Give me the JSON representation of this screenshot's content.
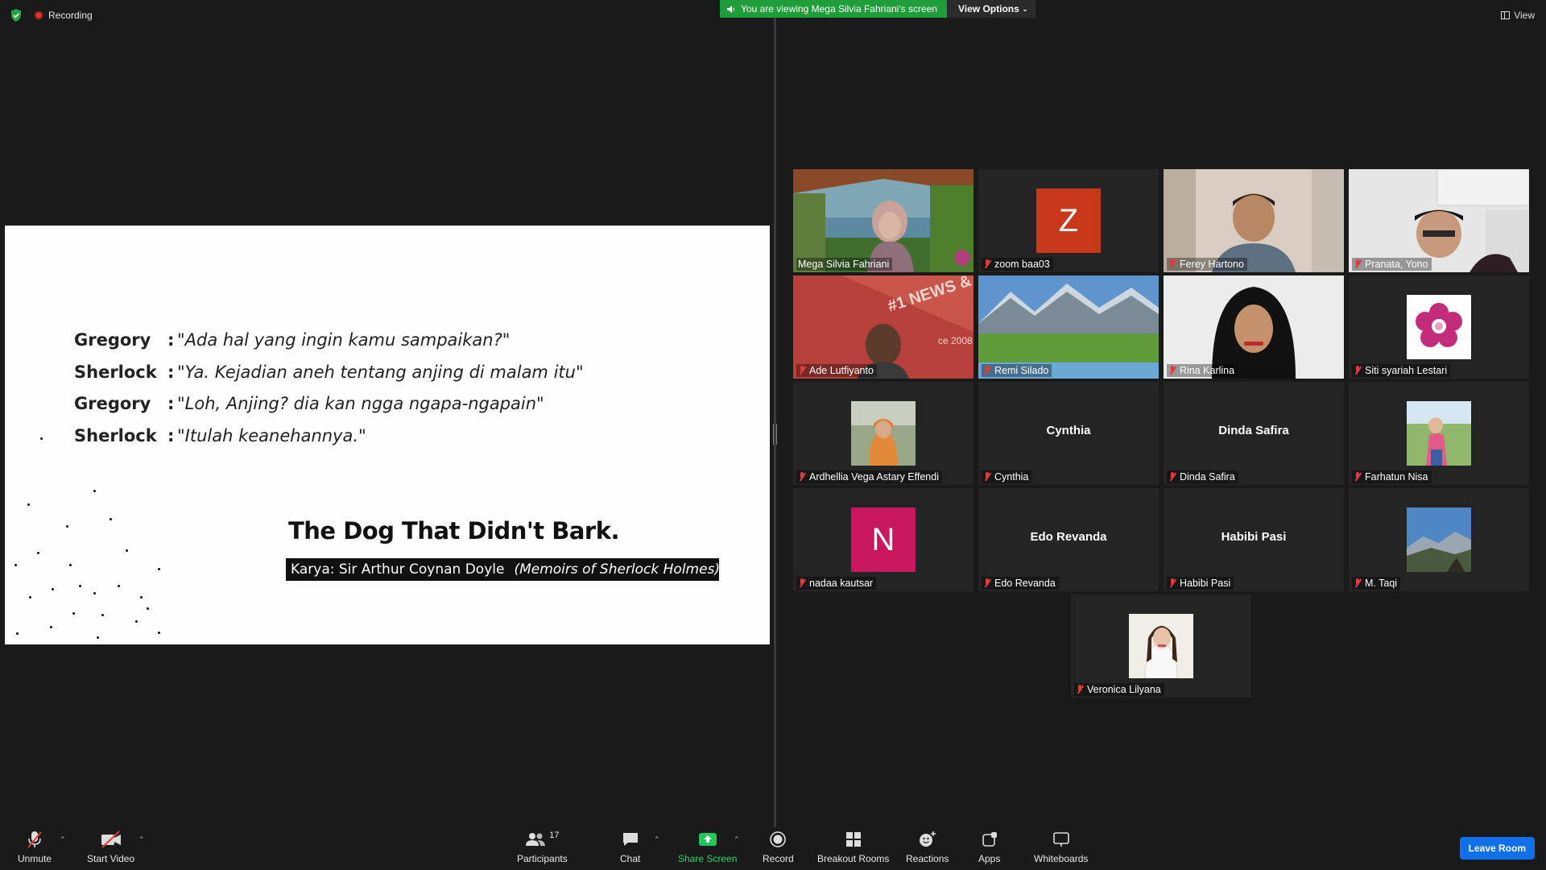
{
  "status": {
    "recording_label": "Recording"
  },
  "banner": {
    "message": "You are viewing Mega Silvia Fahriani's screen",
    "view_options": "View Options"
  },
  "view_button": "View",
  "slide": {
    "dialog": [
      {
        "speaker": "Gregory",
        "colon": ":",
        "line": "\"Ada hal yang ingin kamu sampaikan?\""
      },
      {
        "speaker": "Sherlock",
        "colon": ":",
        "line": "\"Ya. Kejadian aneh tentang anjing di malam itu\""
      },
      {
        "speaker": "Gregory",
        "colon": ":",
        "line": "\"Loh, Anjing? dia kan ngga ngapa-ngapain\""
      },
      {
        "speaker": "Sherlock",
        "colon": ":",
        "line": "\"Itulah keanehannya.\""
      }
    ],
    "title": "The Dog That Didn't Bark.",
    "caption_author": "Karya: Sir Arthur Coynan Doyle",
    "caption_book": "(Memoirs of Sherlock Holmes)"
  },
  "participants": [
    {
      "name": "Mega Silvia Fahriani",
      "muted": false,
      "kind": "video",
      "active": true
    },
    {
      "name": "zoom baa03",
      "muted": true,
      "kind": "letter",
      "letter": "Z",
      "color": "#c9381b"
    },
    {
      "name": "Ferey Hartono",
      "muted": true,
      "kind": "video"
    },
    {
      "name": "Pranata, Yono",
      "muted": true,
      "kind": "video"
    },
    {
      "name": "Ade Lutfiyanto",
      "muted": true,
      "kind": "video"
    },
    {
      "name": "Remi Silado",
      "muted": true,
      "kind": "video"
    },
    {
      "name": "Rina Karlina",
      "muted": true,
      "kind": "video"
    },
    {
      "name": "Siti syariah Lestari",
      "muted": true,
      "kind": "flower"
    },
    {
      "name": "Ardhellia Vega Astary Effendi",
      "muted": true,
      "kind": "photo"
    },
    {
      "name": "Cynthia",
      "muted": true,
      "kind": "text",
      "display": "Cynthia"
    },
    {
      "name": "Dinda Safira",
      "muted": true,
      "kind": "text",
      "display": "Dinda Safira"
    },
    {
      "name": "Farhatun Nisa",
      "muted": true,
      "kind": "photo"
    },
    {
      "name": "nadaa kautsar",
      "muted": true,
      "kind": "letter",
      "letter": "N",
      "color": "#c8175e"
    },
    {
      "name": "Edo Revanda",
      "muted": true,
      "kind": "text",
      "display": "Edo Revanda"
    },
    {
      "name": "Habibi Pasi",
      "muted": true,
      "kind": "text",
      "display": "Habibi Pasi"
    },
    {
      "name": "M. Taqi",
      "muted": true,
      "kind": "photo"
    },
    {
      "name": "Veronica Lilyana",
      "muted": true,
      "kind": "photo"
    }
  ],
  "toolbar": {
    "unmute": "Unmute",
    "start_video": "Start Video",
    "participants": "Participants",
    "participants_count": "17",
    "chat": "Chat",
    "share_screen": "Share Screen",
    "record": "Record",
    "breakout_rooms": "Breakout Rooms",
    "reactions": "Reactions",
    "apps": "Apps",
    "whiteboards": "Whiteboards",
    "leave_room": "Leave Room"
  },
  "colors": {
    "share_green": "#1f9d3b",
    "leave_blue": "#0e71eb",
    "active_speaker": "#d9e21b",
    "muted_red": "#e23a3a"
  }
}
